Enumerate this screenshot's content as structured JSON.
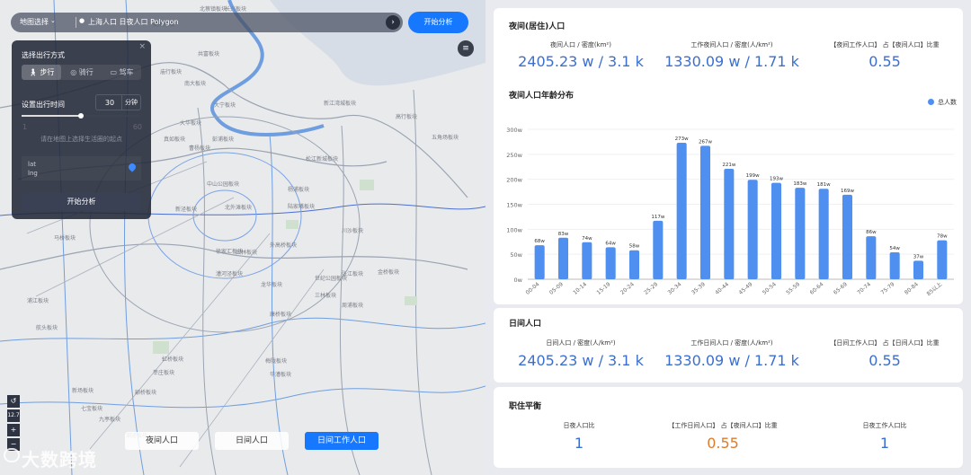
{
  "map": {
    "labels": [
      "北蔡镇板块",
      "吴淞板块",
      "长兴板块",
      "庙行板块",
      "南大板块",
      "大华板块",
      "共富板块",
      "真如板块",
      "曹杨板块",
      "新泾板块",
      "中山公园板块",
      "徐家汇板块",
      "田林板块",
      "漕河泾板块",
      "龙华板块",
      "梅陇板块",
      "华漕板块",
      "虹桥板块",
      "莘庄板块",
      "颛桥板块",
      "七宝板块",
      "九亭板块",
      "泗泾板块",
      "松江新城板块",
      "陆家嘴板块",
      "世纪公园板块",
      "张江板块",
      "金桥板块",
      "三林板块",
      "周浦板块",
      "康桥板块",
      "川沙板块",
      "外高桥板块",
      "高行板块",
      "五角场板块",
      "新江湾城板块",
      "大宁板块",
      "彭浦板块",
      "北外滩板块",
      "杨浦板块",
      "马桥板块",
      "浦江板块",
      "航头板块",
      "新场板块"
    ],
    "topbar": {
      "region": "地图选择",
      "query": "上海人口 日夜人口 Polygon",
      "go_icon": "›"
    },
    "start_button": "开始分析",
    "layers_icon": "≡",
    "panel": {
      "close": "×",
      "title": "选择出行方式",
      "modes": [
        {
          "label": "步行",
          "icon": "walk-icon",
          "active": true
        },
        {
          "label": "骑行",
          "icon": "bike-icon",
          "active": false
        },
        {
          "label": "驾车",
          "icon": "car-icon",
          "active": false
        }
      ],
      "time_label": "设置出行时间",
      "time_value": "30",
      "time_unit": "分钟",
      "slider_value": 30,
      "slider_min": "1",
      "slider_max": "60",
      "hint": "请在地图上选择生活圈的起点",
      "lat_label": "lat",
      "lng_label": "lng",
      "analyze_button": "开始分析"
    },
    "zoom": {
      "reset": "↺",
      "level": "12.7",
      "plus": "+",
      "minus": "−"
    },
    "watermark": "大数跨境",
    "tabs": [
      {
        "label": "夜间人口",
        "active": false
      },
      {
        "label": "日间人口",
        "active": false
      },
      {
        "label": "日间工作人口",
        "active": true
      }
    ]
  },
  "night": {
    "title": "夜间(居住)人口",
    "stats": [
      {
        "label": "夜间人口 / 密度(km²)",
        "value": "2405.23 w  /  3.1 k"
      },
      {
        "label": "工作夜间人口 / 密度(人/km²)",
        "value": "1330.09 w  /  1.71 k"
      },
      {
        "label": "【夜间工作人口】 占【夜间人口】比重",
        "value": "0.55"
      }
    ],
    "chart_title": "夜间人口年龄分布",
    "legend": "总人数"
  },
  "day": {
    "title": "日间人口",
    "stats": [
      {
        "label": "日间人口 / 密度(人/km²)",
        "value": "2405.23 w  /  3.1 k"
      },
      {
        "label": "工作日间人口 / 密度(人/km²)",
        "value": "1330.09 w  /  1.71 k"
      },
      {
        "label": "【日间工作人口】 占【日间人口】比重",
        "value": "0.55"
      }
    ]
  },
  "balance": {
    "title": "职住平衡",
    "stats": [
      {
        "label": "日夜人口比",
        "value": "1"
      },
      {
        "label": "【工作日间人口】 占【夜间人口】比重",
        "value": "0.55"
      },
      {
        "label": "日夜工作人口比",
        "value": "1"
      }
    ]
  },
  "colors": {
    "accent": "#1677ff",
    "bar": "#4f8ff0",
    "orange": "#e07b28",
    "value_blue": "#3a6fcf"
  },
  "chart_data": {
    "type": "bar",
    "title": "夜间人口年龄分布",
    "categories": [
      "00-04",
      "05-09",
      "10-14",
      "15-19",
      "20-24",
      "25-29",
      "30-34",
      "35-39",
      "40-44",
      "45-49",
      "50-54",
      "55-59",
      "60-64",
      "65-69",
      "70-74",
      "75-79",
      "80-84",
      "85以上"
    ],
    "series": [
      {
        "name": "总人数",
        "values": [
          68,
          83,
          74,
          64,
          58,
          117,
          273,
          267,
          221,
          199,
          193,
          183,
          181,
          169,
          86,
          54,
          37,
          78
        ]
      }
    ],
    "value_labels": [
      "68w",
      "83w",
      "74w",
      "64w",
      "58w",
      "117w",
      "273w",
      "267w",
      "221w",
      "199w",
      "193w",
      "183w",
      "181w",
      "169w",
      "86w",
      "54w",
      "37w",
      "78w"
    ],
    "yticks": [
      "0w",
      "50w",
      "100w",
      "150w",
      "200w",
      "250w",
      "300w"
    ],
    "ylim": [
      0,
      300
    ],
    "legend_position": "top-right"
  }
}
